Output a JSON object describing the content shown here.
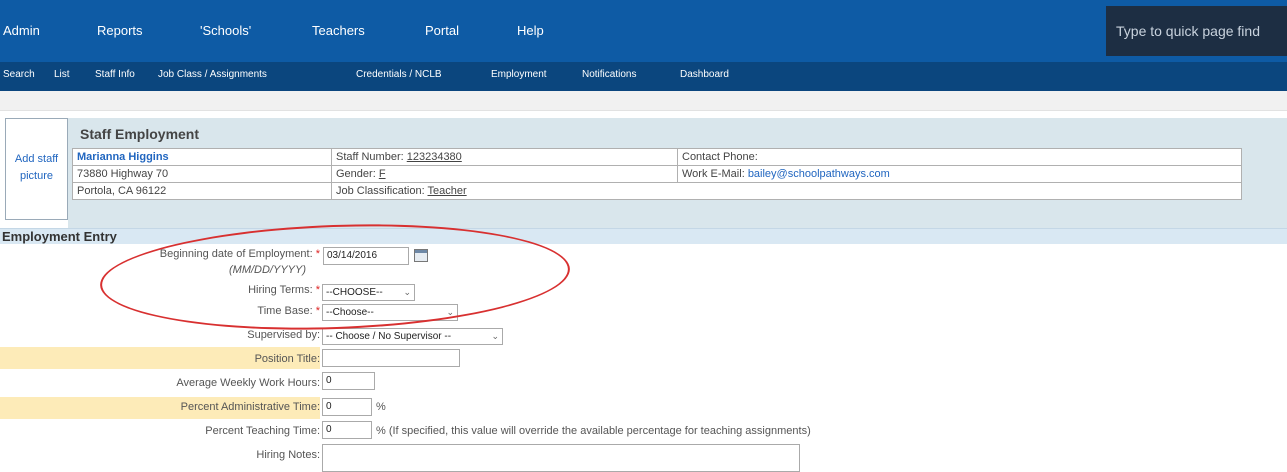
{
  "topnav": {
    "items": [
      "Admin",
      "Reports",
      "'Schools'",
      "Teachers",
      "Portal",
      "Help"
    ],
    "quickfind_placeholder": "Type to quick page find"
  },
  "subnav": {
    "items": [
      "Search",
      "List",
      "Staff Info",
      "Job Class / Assignments",
      "Credentials / NCLB",
      "Employment",
      "Notifications",
      "Dashboard"
    ]
  },
  "staff": {
    "add_picture": "Add staff picture",
    "title": "Staff Employment",
    "name": "Marianna Higgins",
    "address1": "73880 Highway 70",
    "address2": "Portola, CA 96122",
    "staff_number_label": "Staff Number:",
    "staff_number": "123234380",
    "gender_label": "Gender:",
    "gender": "F",
    "job_class_label": "Job Classification:",
    "job_class": "Teacher",
    "contact_phone_label": "Contact Phone:",
    "work_email_label": "Work E-Mail:",
    "work_email": "bailey@schoolpathways.com"
  },
  "entry": {
    "section_title": "Employment Entry",
    "begin_date_label": "Beginning date of Employment:",
    "begin_date_format": "(MM/DD/YYYY)",
    "begin_date_value": "03/14/2016",
    "hiring_terms_label": "Hiring Terms:",
    "hiring_terms_value": "--CHOOSE--",
    "time_base_label": "Time Base:",
    "time_base_value": "--Choose--",
    "supervised_by_label": "Supervised by:",
    "supervised_by_value": "-- Choose / No Supervisor --",
    "position_title_label": "Position Title:",
    "position_title_value": "",
    "avg_hours_label": "Average Weekly Work Hours:",
    "avg_hours_value": "0",
    "pct_admin_label": "Percent Administrative Time:",
    "pct_admin_value": "0",
    "pct_admin_suffix": "%",
    "pct_teach_label": "Percent Teaching Time:",
    "pct_teach_value": "0",
    "pct_teach_suffix": "% (If specified, this value will override the available percentage for teaching assignments)",
    "hiring_notes_label": "Hiring Notes:",
    "hiring_notes_value": ""
  },
  "colors": {
    "topnav": "#0e5ba5",
    "subnav": "#0b467e",
    "highlight_oval": "#d83030",
    "yellow_row": "#fdebb8"
  }
}
